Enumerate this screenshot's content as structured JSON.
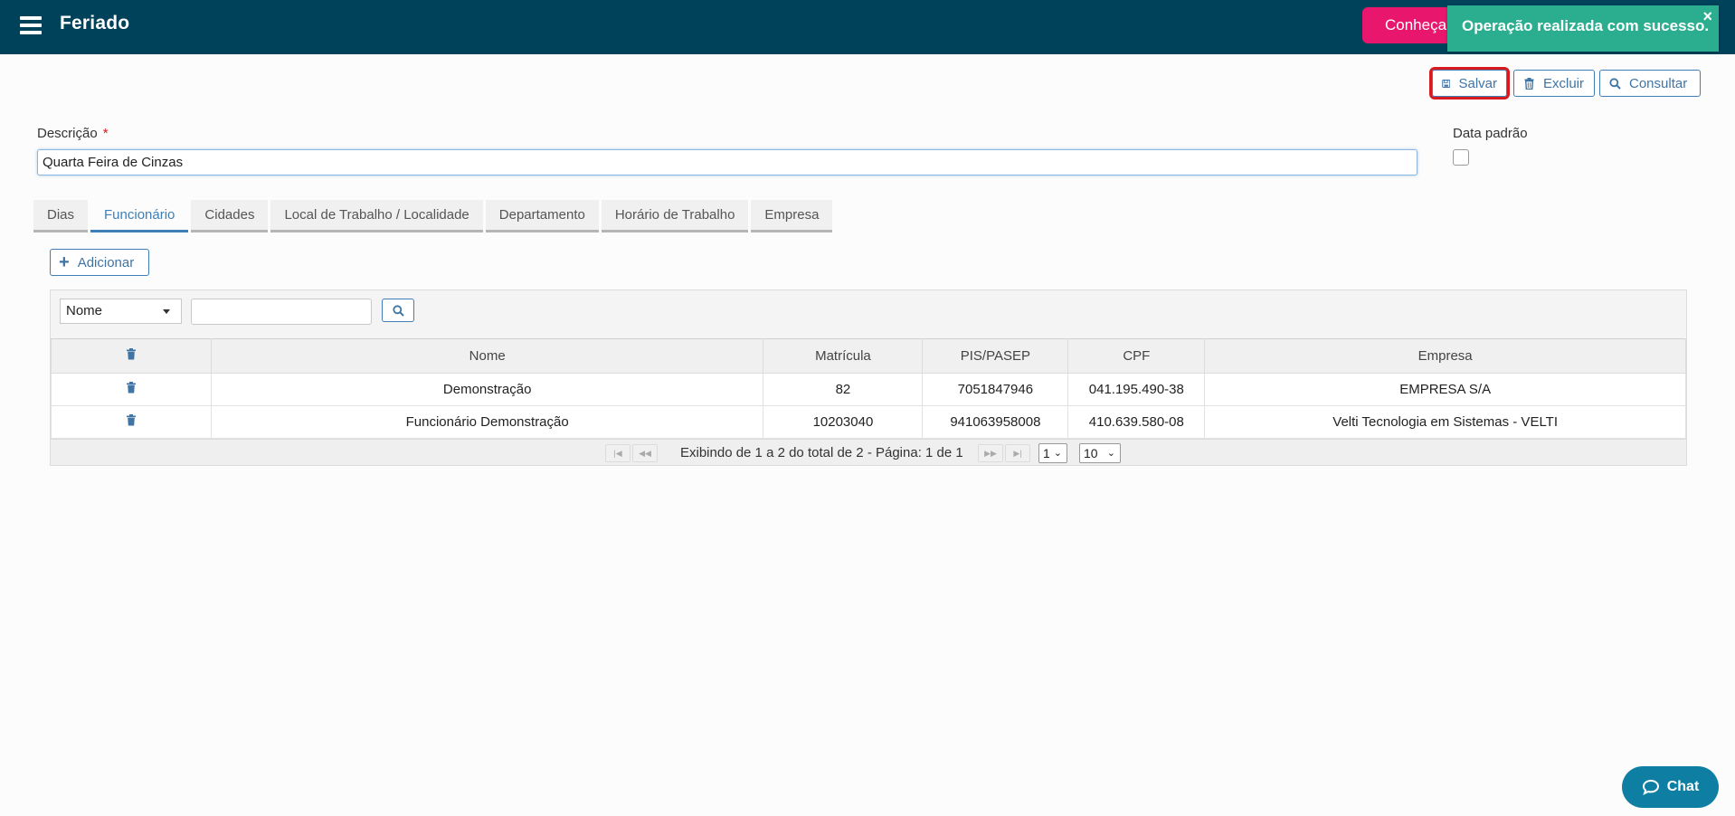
{
  "header": {
    "title": "Feriado",
    "promo_label": "Conheça",
    "toast_message": "Operação realizada com sucesso.",
    "toast_close": "×"
  },
  "actions": {
    "save_label": "Salvar",
    "delete_label": "Excluir",
    "query_label": "Consultar"
  },
  "form": {
    "description_label": "Descrição",
    "required_mark": "*",
    "description_value": "Quarta Feira de Cinzas",
    "default_date_label": "Data padrão",
    "default_date_checked": false
  },
  "tabs": [
    {
      "label": "Dias",
      "active": false
    },
    {
      "label": "Funcionário",
      "active": true
    },
    {
      "label": "Cidades",
      "active": false
    },
    {
      "label": "Local de Trabalho / Localidade",
      "active": false
    },
    {
      "label": "Departamento",
      "active": false
    },
    {
      "label": "Horário de Trabalho",
      "active": false
    },
    {
      "label": "Empresa",
      "active": false
    }
  ],
  "add_label": "Adicionar",
  "filter": {
    "field_selected": "Nome",
    "search_value": ""
  },
  "table": {
    "columns": [
      "Nome",
      "Matrícula",
      "PIS/PASEP",
      "CPF",
      "Empresa"
    ],
    "rows": [
      {
        "nome": "Demonstração",
        "matricula": "82",
        "pis": "7051847946",
        "cpf": "041.195.490-38",
        "empresa": "EMPRESA S/A"
      },
      {
        "nome": "Funcionário Demonstração",
        "matricula": "10203040",
        "pis": "941063958008",
        "cpf": "410.639.580-08",
        "empresa": "Velti Tecnologia em Sistemas - VELTI"
      }
    ]
  },
  "pager": {
    "summary": "Exibindo de 1 a 2 do total de 2 - Página: 1 de 1",
    "page_selected": "1",
    "page_size_selected": "10"
  },
  "chat_label": "Chat",
  "colors": {
    "topbar": "#00425a",
    "accent": "#3f7eb6",
    "toast": "#2bae8f",
    "promo": "#e8176d",
    "highlight": "#d71920",
    "chat": "#0e7fa3"
  }
}
